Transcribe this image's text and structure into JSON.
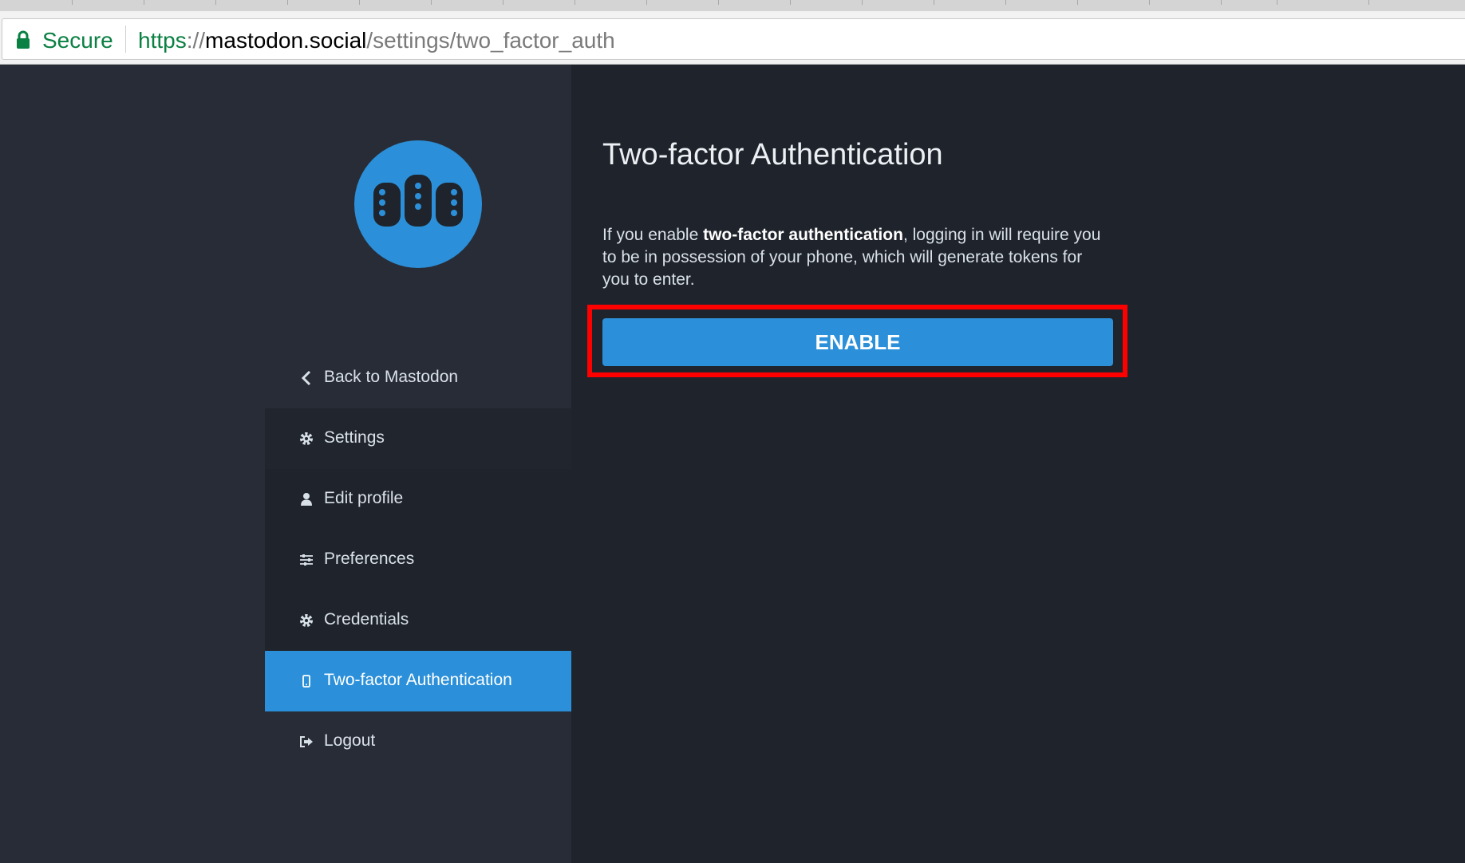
{
  "browser": {
    "secure_label": "Secure",
    "url": {
      "scheme": "https",
      "separator": "://",
      "host": "mastodon.social",
      "path": "/settings/two_factor_auth"
    }
  },
  "sidebar": {
    "items": [
      {
        "label": "Back to Mastodon",
        "icon": "chevron-left-icon"
      },
      {
        "label": "Settings",
        "icon": "gear-icon"
      },
      {
        "label": "Edit profile",
        "icon": "user-icon"
      },
      {
        "label": "Preferences",
        "icon": "sliders-icon"
      },
      {
        "label": "Credentials",
        "icon": "gear-icon"
      },
      {
        "label": "Two-factor Authentication",
        "icon": "mobile-phone-icon",
        "active": true
      },
      {
        "label": "Logout",
        "icon": "sign-out-icon"
      }
    ]
  },
  "main": {
    "title": "Two-factor Authentication",
    "description": {
      "before": "If you enable ",
      "bold": "two-factor authentication",
      "after": ", logging in will require you to be in possession of your phone, which will generate tokens for you to enter."
    },
    "enable_label": "ENABLE"
  },
  "colors": {
    "accent": "#2b90d9",
    "sidebar_bg": "#282c37",
    "content_bg": "#1f232b",
    "highlight": "#ff0000",
    "secure_green": "#0b8043"
  }
}
